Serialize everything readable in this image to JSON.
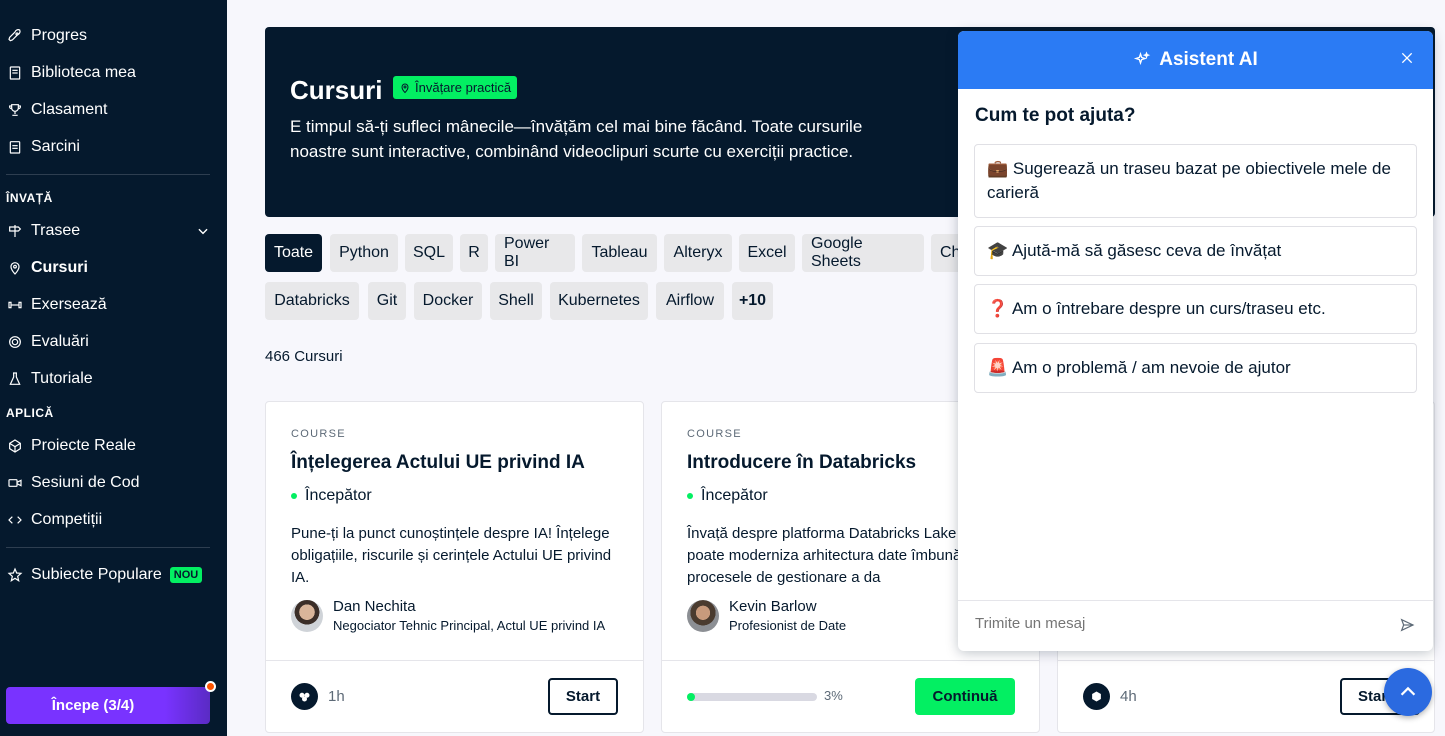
{
  "sidebar": {
    "items_top": [
      {
        "label": "Progres",
        "icon": "rocket-icon"
      },
      {
        "label": "Biblioteca mea",
        "icon": "book-icon"
      },
      {
        "label": "Clasament",
        "icon": "trophy-icon"
      },
      {
        "label": "Sarcini",
        "icon": "clipboard-icon"
      }
    ],
    "section_learn": "ÎNVAȚĂ",
    "items_learn": [
      {
        "label": "Trasee",
        "icon": "signpost-icon"
      },
      {
        "label": "Cursuri",
        "icon": "location-pin-icon"
      },
      {
        "label": "Exersează",
        "icon": "dumbbell-icon"
      },
      {
        "label": "Evaluări",
        "icon": "gauge-icon"
      },
      {
        "label": "Tutoriale",
        "icon": "flask-icon"
      }
    ],
    "section_apply": "APLICĂ",
    "items_apply": [
      {
        "label": "Proiecte Reale",
        "icon": "cube-icon"
      },
      {
        "label": "Sesiuni de Cod",
        "icon": "video-icon"
      },
      {
        "label": "Competiții",
        "icon": "code-icon"
      }
    ],
    "popular_label": "Subiecte Populare",
    "popular_badge": "NOU",
    "start_button": "Începe (3/4)"
  },
  "hero": {
    "title": "Cursuri",
    "badge": "Învățare practică",
    "description": "E timpul să-ți sufleci mânecile—învățăm cel mai bine făcând. Toate cursurile noastre sunt interactive, combinând videoclipuri scurte cu exerciții practice."
  },
  "filters": {
    "row1": [
      "Toate",
      "Python",
      "SQL",
      "R",
      "Power BI",
      "Tableau",
      "Alteryx",
      "Excel",
      "Google Sheets",
      "Ch"
    ],
    "row2": [
      "Databricks",
      "Git",
      "Docker",
      "Shell",
      "Kubernetes",
      "Airflow",
      "+10"
    ]
  },
  "course_count": "466 Cursuri",
  "cards": [
    {
      "type": "COURSE",
      "title": "Înțelegerea Actului UE privind IA",
      "level": "Începător",
      "description": "Pune-ți la punct cunoștințele despre IA! Înțelege obligațiile, riscurile și cerințele Actului UE privind IA.",
      "author_name": "Dan Nechita",
      "author_role": "Negociator Tehnic Principal, Actul UE privind IA",
      "duration": "1h",
      "action": "Start"
    },
    {
      "type": "COURSE",
      "title": "Introducere în Databricks",
      "level": "Începător",
      "description": "Învață despre platforma Databricks Lake și cum poate moderniza arhitectura date îmbunătăți procesele de gestionare a da",
      "author_name": "Kevin Barlow",
      "author_role": "Profesionist de Date",
      "progress": 0.03,
      "progress_label": "3%",
      "action": "Continuă"
    },
    {
      "duration": "4h",
      "action": "Star"
    }
  ],
  "ai_assistant": {
    "title": "Asistent AI",
    "question": "Cum te pot ajuta?",
    "options": [
      "💼 Sugerează un traseu bazat pe obiectivele mele de carieră",
      "🎓 Ajută-mă să găsesc ceva de învățat",
      "❓ Am o întrebare despre un curs/traseu etc.",
      "🚨 Am o problemă / am nevoie de ajutor"
    ],
    "input_placeholder": "Trimite un mesaj"
  },
  "colors": {
    "navy": "#05192d",
    "green": "#03ef62",
    "purple": "#7933ff",
    "blue": "#2b7bf4"
  }
}
